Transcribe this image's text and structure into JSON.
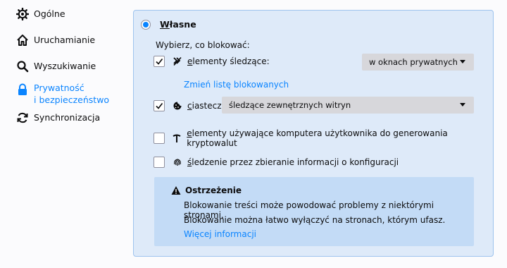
{
  "sidebar": {
    "items": [
      {
        "label": "Ogólne",
        "icon": "gear-icon"
      },
      {
        "label": "Uruchamianie",
        "icon": "home-icon"
      },
      {
        "label": "Wyszukiwanie",
        "icon": "search-icon"
      },
      {
        "label_line1": "Prywatność",
        "label_line2": "i bezpieczeństwo",
        "icon": "lock-icon",
        "selected": true
      },
      {
        "label": "Synchronizacja",
        "icon": "sync-icon"
      }
    ]
  },
  "panel": {
    "radio_label": "Własne",
    "subtitle": "Wybierz, co blokować:",
    "trackers": {
      "label": "elementy śledzące:",
      "checked": true,
      "dropdown_value": "w oknach prywatnych",
      "link": "Zmień listę blokowanych"
    },
    "cookies": {
      "label": "ciasteczka:",
      "checked": true,
      "dropdown_value": "śledzące zewnętrznych witryn"
    },
    "cryptominers": {
      "label": "elementy używające komputera użytkownika do generowania kryptowalut",
      "checked": false
    },
    "fingerprinters": {
      "label": "śledzenie przez zbieranie informacji o konfiguracji",
      "checked": false
    },
    "warning": {
      "title": "Ostrzeżenie",
      "line1": "Blokowanie treści może powodować problemy z niektórymi stronami.",
      "line2": "Blokowanie można łatwo wyłączyć na stronach, którym ufasz.",
      "link": "Więcej informacji"
    }
  },
  "colors": {
    "accent": "#0a84ff",
    "panel_bg": "#deeaf9",
    "panel_border": "#9ec3ee",
    "warning_bg": "#c3dbf6"
  }
}
